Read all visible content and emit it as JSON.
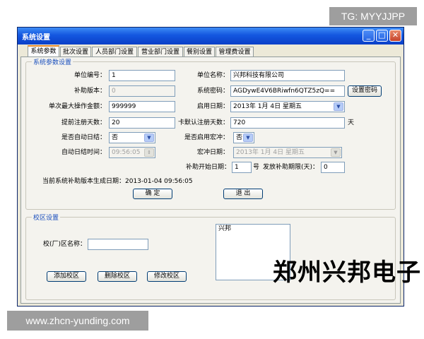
{
  "overlay": {
    "tg": "TG: MYYJJPP",
    "url": "www.zhcn-yunding.com",
    "watermark": "郑州兴邦电子"
  },
  "window": {
    "title": "系统设置",
    "btn_min": "_",
    "btn_max": "□",
    "btn_close": "✕"
  },
  "tabs": [
    "系统参数",
    "批次设置",
    "人员部门设置",
    "营业部门设置",
    "餐别设置",
    "管理费设置"
  ],
  "sys": {
    "group_title": "系统参数设置",
    "unit_no_label": "单位编号：",
    "unit_no": "1",
    "unit_name_label": "单位名称：",
    "unit_name": "兴邦科技有限公司",
    "subsidy_ver_label": "补助版本：",
    "subsidy_ver": "0",
    "sys_pwd_label": "系统密码：",
    "sys_pwd": "AGDywE4V6BRiwfn6QTZ5zQ==",
    "set_pwd_button": "设置密码",
    "max_amount_label": "单次最大操作金额：",
    "max_amount": "999999",
    "enable_date_label": "启用日期：",
    "enable_date": "2013年  1月  4日   星期五",
    "reg_days_label": "提前注册天数：",
    "reg_days": "20",
    "card_days_label": "卡默认注册天数：",
    "card_days": "720",
    "card_days_unit": "天",
    "auto_close_label": "是否自动日结：",
    "auto_close": "否",
    "macro_label": "是否启用宏冲：",
    "macro": "否",
    "auto_close_time_label": "自动日结时间：",
    "auto_close_time": "09:56:05",
    "macro_date_label": "宏冲日期：",
    "macro_date": "2013年  1月  4日   星期五",
    "subsidy_start_label": "补助开始日期：",
    "subsidy_start": "1",
    "subsidy_start_unit": "号",
    "subsidy_limit_label": "发放补助期限(天)：",
    "subsidy_limit": "0",
    "gen_date_text": "当前系统补助版本生成日期：2013-01-04  09:56:05",
    "ok_button": "确  定",
    "exit_button": "退  出"
  },
  "campus": {
    "group_title": "校区设置",
    "name_label": "校(厂)区名称：",
    "name_value": "",
    "list": [
      "兴邦"
    ],
    "add_button": "添加校区",
    "delete_button": "删除校区",
    "edit_button": "修改校区"
  }
}
